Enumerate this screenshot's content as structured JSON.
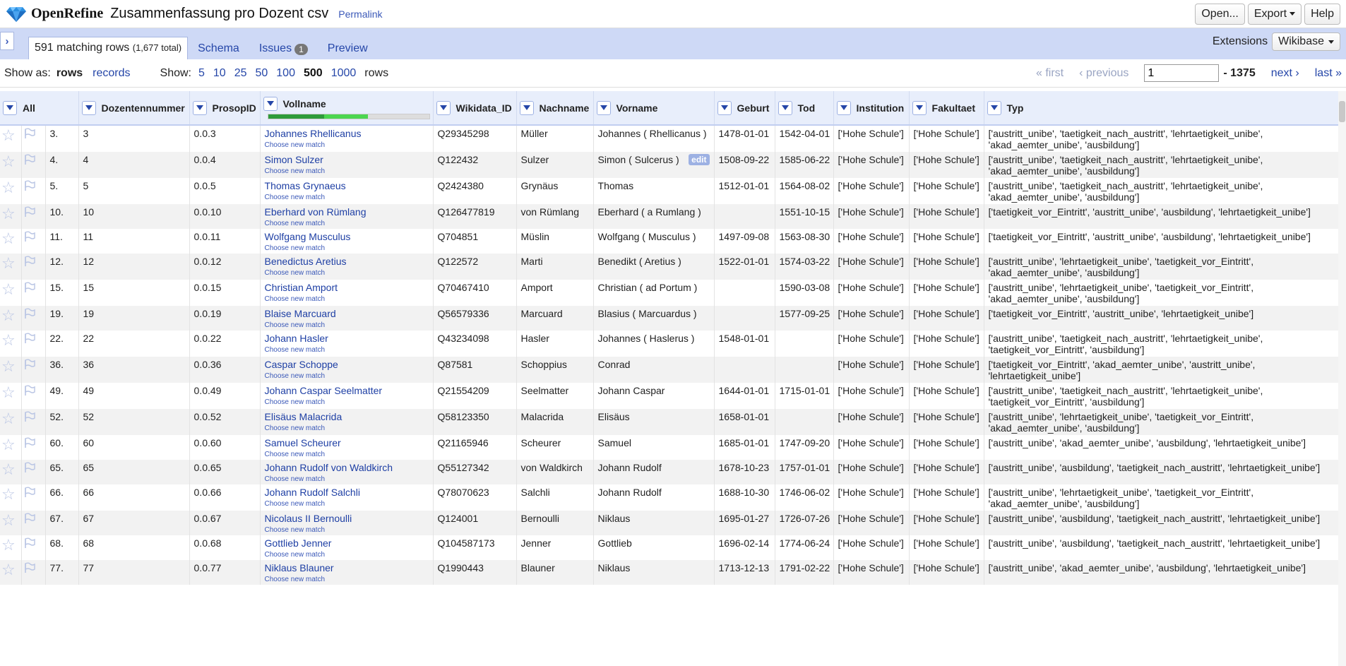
{
  "header": {
    "app_name": "OpenRefine",
    "project_name": "Zusammenfassung pro Dozent csv",
    "permalink": "Permalink",
    "buttons": {
      "open": "Open...",
      "export": "Export",
      "help": "Help"
    }
  },
  "tabs": {
    "count_main": "591 matching rows",
    "count_total": "(1,677 total)",
    "schema": "Schema",
    "issues": "Issues",
    "issues_count": "1",
    "preview": "Preview",
    "extensions": "Extensions",
    "wikibase": "Wikibase"
  },
  "options": {
    "show_as": "Show as:",
    "rows": "rows",
    "records": "records",
    "show": "Show:",
    "page_sizes": [
      "5",
      "10",
      "25",
      "50",
      "100",
      "500",
      "1000"
    ],
    "rows_suffix": "rows",
    "first": "« first",
    "previous": "‹ previous",
    "page_value": "1",
    "page_total": "- 1375",
    "next": "next ›",
    "last": "last »"
  },
  "columns": [
    "All",
    "Dozentennummer",
    "ProsopID",
    "Vollname",
    "Wikidata_ID",
    "Nachname",
    "Vorname",
    "Geburt",
    "Tod",
    "Institution",
    "Fakultaet",
    "Typ"
  ],
  "choose_label": "Choose new match",
  "edit_label": "edit",
  "rows": [
    {
      "idx": "3.",
      "nr": "3",
      "pid": "0.0.3",
      "voll": "Johannes Rhellicanus",
      "wd": "Q29345298",
      "nach": "Müller",
      "vor": "Johannes ( Rhellicanus )",
      "geb": "1478-01-01",
      "tod": "1542-04-01",
      "inst": "['Hohe Schule']",
      "fak": "['Hohe Schule']",
      "typ": "['austritt_unibe', 'taetigkeit_nach_austritt', 'lehrtaetigkeit_unibe', 'akad_aemter_unibe', 'ausbildung']"
    },
    {
      "idx": "4.",
      "nr": "4",
      "pid": "0.0.4",
      "voll": "Simon Sulzer",
      "wd": "Q122432",
      "nach": "Sulzer",
      "vor": "Simon ( Sulcerus )",
      "geb": "1508-09-22",
      "tod": "1585-06-22",
      "inst": "['Hohe Schule']",
      "fak": "['Hohe Schule']",
      "typ": "['austritt_unibe', 'taetigkeit_nach_austritt', 'lehrtaetigkeit_unibe', 'akad_aemter_unibe', 'ausbildung']"
    },
    {
      "idx": "5.",
      "nr": "5",
      "pid": "0.0.5",
      "voll": "Thomas Grynaeus",
      "wd": "Q2424380",
      "nach": "Grynäus",
      "vor": "Thomas",
      "geb": "1512-01-01",
      "tod": "1564-08-02",
      "inst": "['Hohe Schule']",
      "fak": "['Hohe Schule']",
      "typ": "['austritt_unibe', 'taetigkeit_nach_austritt', 'lehrtaetigkeit_unibe', 'akad_aemter_unibe', 'ausbildung']"
    },
    {
      "idx": "10.",
      "nr": "10",
      "pid": "0.0.10",
      "voll": "Eberhard von Rümlang",
      "wd": "Q126477819",
      "nach": "von Rümlang",
      "vor": "Eberhard ( a Rumlang )",
      "geb": "",
      "tod": "1551-10-15",
      "inst": "['Hohe Schule']",
      "fak": "['Hohe Schule']",
      "typ": "['taetigkeit_vor_Eintritt', 'austritt_unibe', 'ausbildung', 'lehrtaetigkeit_unibe']"
    },
    {
      "idx": "11.",
      "nr": "11",
      "pid": "0.0.11",
      "voll": "Wolfgang Musculus",
      "wd": "Q704851",
      "nach": "Müslin",
      "vor": "Wolfgang ( Musculus )",
      "geb": "1497-09-08",
      "tod": "1563-08-30",
      "inst": "['Hohe Schule']",
      "fak": "['Hohe Schule']",
      "typ": "['taetigkeit_vor_Eintritt', 'austritt_unibe', 'ausbildung', 'lehrtaetigkeit_unibe']"
    },
    {
      "idx": "12.",
      "nr": "12",
      "pid": "0.0.12",
      "voll": "Benedictus Aretius",
      "wd": "Q122572",
      "nach": "Marti",
      "vor": "Benedikt ( Aretius )",
      "geb": "1522-01-01",
      "tod": "1574-03-22",
      "inst": "['Hohe Schule']",
      "fak": "['Hohe Schule']",
      "typ": "['austritt_unibe', 'lehrtaetigkeit_unibe', 'taetigkeit_vor_Eintritt', 'akad_aemter_unibe', 'ausbildung']"
    },
    {
      "idx": "15.",
      "nr": "15",
      "pid": "0.0.15",
      "voll": "Christian Amport",
      "wd": "Q70467410",
      "nach": "Amport",
      "vor": "Christian ( ad Portum )",
      "geb": "",
      "tod": "1590-03-08",
      "inst": "['Hohe Schule']",
      "fak": "['Hohe Schule']",
      "typ": "['austritt_unibe', 'lehrtaetigkeit_unibe', 'taetigkeit_vor_Eintritt', 'akad_aemter_unibe', 'ausbildung']"
    },
    {
      "idx": "19.",
      "nr": "19",
      "pid": "0.0.19",
      "voll": "Blaise Marcuard",
      "wd": "Q56579336",
      "nach": "Marcuard",
      "vor": "Blasius ( Marcuardus )",
      "geb": "",
      "tod": "1577-09-25",
      "inst": "['Hohe Schule']",
      "fak": "['Hohe Schule']",
      "typ": "['taetigkeit_vor_Eintritt', 'austritt_unibe', 'lehrtaetigkeit_unibe']"
    },
    {
      "idx": "22.",
      "nr": "22",
      "pid": "0.0.22",
      "voll": "Johann Hasler",
      "wd": "Q43234098",
      "nach": "Hasler",
      "vor": "Johannes ( Haslerus )",
      "geb": "1548-01-01",
      "tod": "",
      "inst": "['Hohe Schule']",
      "fak": "['Hohe Schule']",
      "typ": "['austritt_unibe', 'taetigkeit_nach_austritt', 'lehrtaetigkeit_unibe', 'taetigkeit_vor_Eintritt', 'ausbildung']"
    },
    {
      "idx": "36.",
      "nr": "36",
      "pid": "0.0.36",
      "voll": "Caspar Schoppe",
      "wd": "Q87581",
      "nach": "Schoppius",
      "vor": "Conrad",
      "geb": "",
      "tod": "",
      "inst": "['Hohe Schule']",
      "fak": "['Hohe Schule']",
      "typ": "['taetigkeit_vor_Eintritt', 'akad_aemter_unibe', 'austritt_unibe', 'lehrtaetigkeit_unibe']"
    },
    {
      "idx": "49.",
      "nr": "49",
      "pid": "0.0.49",
      "voll": "Johann Caspar Seelmatter",
      "wd": "Q21554209",
      "nach": "Seelmatter",
      "vor": "Johann Caspar",
      "geb": "1644-01-01",
      "tod": "1715-01-01",
      "inst": "['Hohe Schule']",
      "fak": "['Hohe Schule']",
      "typ": "['austritt_unibe', 'taetigkeit_nach_austritt', 'lehrtaetigkeit_unibe', 'taetigkeit_vor_Eintritt', 'ausbildung']"
    },
    {
      "idx": "52.",
      "nr": "52",
      "pid": "0.0.52",
      "voll": "Elisäus Malacrida",
      "wd": "Q58123350",
      "nach": "Malacrida",
      "vor": "Elisäus",
      "geb": "1658-01-01",
      "tod": "",
      "inst": "['Hohe Schule']",
      "fak": "['Hohe Schule']",
      "typ": "['austritt_unibe', 'lehrtaetigkeit_unibe', 'taetigkeit_vor_Eintritt', 'akad_aemter_unibe', 'ausbildung']"
    },
    {
      "idx": "60.",
      "nr": "60",
      "pid": "0.0.60",
      "voll": "Samuel Scheurer",
      "wd": "Q21165946",
      "nach": "Scheurer",
      "vor": "Samuel",
      "geb": "1685-01-01",
      "tod": "1747-09-20",
      "inst": "['Hohe Schule']",
      "fak": "['Hohe Schule']",
      "typ": "['austritt_unibe', 'akad_aemter_unibe', 'ausbildung', 'lehrtaetigkeit_unibe']"
    },
    {
      "idx": "65.",
      "nr": "65",
      "pid": "0.0.65",
      "voll": "Johann Rudolf von Waldkirch",
      "wd": "Q55127342",
      "nach": "von Waldkirch",
      "vor": "Johann Rudolf",
      "geb": "1678-10-23",
      "tod": "1757-01-01",
      "inst": "['Hohe Schule']",
      "fak": "['Hohe Schule']",
      "typ": "['austritt_unibe', 'ausbildung', 'taetigkeit_nach_austritt', 'lehrtaetigkeit_unibe']"
    },
    {
      "idx": "66.",
      "nr": "66",
      "pid": "0.0.66",
      "voll": "Johann Rudolf Salchli",
      "wd": "Q78070623",
      "nach": "Salchli",
      "vor": "Johann Rudolf",
      "geb": "1688-10-30",
      "tod": "1746-06-02",
      "inst": "['Hohe Schule']",
      "fak": "['Hohe Schule']",
      "typ": "['austritt_unibe', 'lehrtaetigkeit_unibe', 'taetigkeit_vor_Eintritt', 'akad_aemter_unibe', 'ausbildung']"
    },
    {
      "idx": "67.",
      "nr": "67",
      "pid": "0.0.67",
      "voll": "Nicolaus II Bernoulli",
      "wd": "Q124001",
      "nach": "Bernoulli",
      "vor": "Niklaus",
      "geb": "1695-01-27",
      "tod": "1726-07-26",
      "inst": "['Hohe Schule']",
      "fak": "['Hohe Schule']",
      "typ": "['austritt_unibe', 'ausbildung', 'taetigkeit_nach_austritt', 'lehrtaetigkeit_unibe']"
    },
    {
      "idx": "68.",
      "nr": "68",
      "pid": "0.0.68",
      "voll": "Gottlieb Jenner",
      "wd": "Q104587173",
      "nach": "Jenner",
      "vor": "Gottlieb",
      "geb": "1696-02-14",
      "tod": "1774-06-24",
      "inst": "['Hohe Schule']",
      "fak": "['Hohe Schule']",
      "typ": "['austritt_unibe', 'ausbildung', 'taetigkeit_nach_austritt', 'lehrtaetigkeit_unibe']"
    },
    {
      "idx": "77.",
      "nr": "77",
      "pid": "0.0.77",
      "voll": "Niklaus Blauner",
      "wd": "Q1990443",
      "nach": "Blauner",
      "vor": "Niklaus",
      "geb": "1713-12-13",
      "tod": "1791-02-22",
      "inst": "['Hohe Schule']",
      "fak": "['Hohe Schule']",
      "typ": "['austritt_unibe', 'akad_aemter_unibe', 'ausbildung', 'lehrtaetigkeit_unibe']"
    }
  ]
}
